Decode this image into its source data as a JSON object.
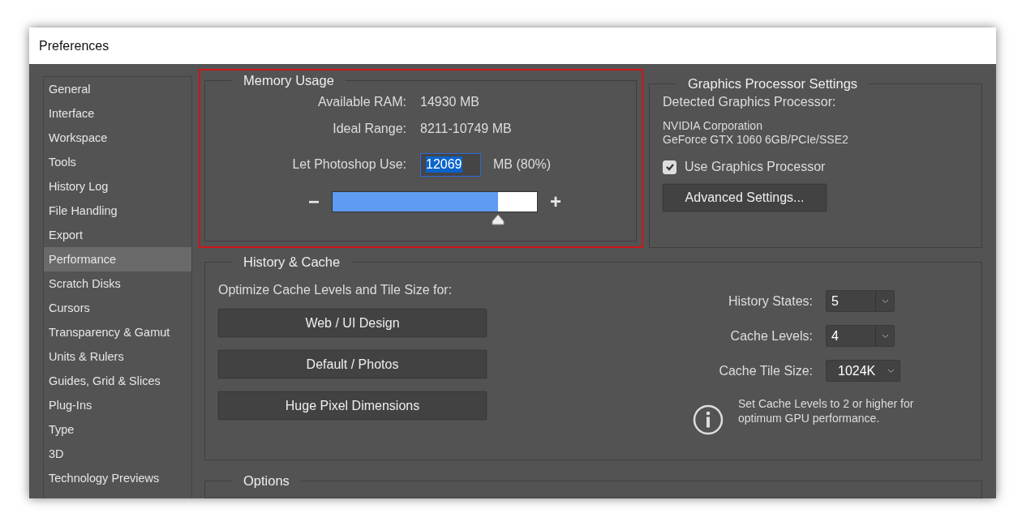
{
  "window": {
    "title": "Preferences"
  },
  "sidebar": {
    "items": [
      {
        "label": "General",
        "selected": false
      },
      {
        "label": "Interface",
        "selected": false
      },
      {
        "label": "Workspace",
        "selected": false
      },
      {
        "label": "Tools",
        "selected": false
      },
      {
        "label": "History Log",
        "selected": false
      },
      {
        "label": "File Handling",
        "selected": false
      },
      {
        "label": "Export",
        "selected": false
      },
      {
        "label": "Performance",
        "selected": true
      },
      {
        "label": "Scratch Disks",
        "selected": false
      },
      {
        "label": "Cursors",
        "selected": false
      },
      {
        "label": "Transparency & Gamut",
        "selected": false
      },
      {
        "label": "Units & Rulers",
        "selected": false
      },
      {
        "label": "Guides, Grid & Slices",
        "selected": false
      },
      {
        "label": "Plug-Ins",
        "selected": false
      },
      {
        "label": "Type",
        "selected": false
      },
      {
        "label": "3D",
        "selected": false
      },
      {
        "label": "Technology Previews",
        "selected": false
      }
    ]
  },
  "memory_usage": {
    "title": "Memory Usage",
    "highlighted": true,
    "rows": [
      {
        "label": "Available RAM:",
        "value": "14930 MB"
      },
      {
        "label": "Ideal Range:",
        "value": "8211-10749 MB"
      }
    ],
    "use": {
      "label": "Let Photoshop Use:",
      "value": "12069",
      "suffix": "MB (80%)"
    },
    "slider": {
      "minus": "−",
      "plus": "+",
      "level": 0.81
    }
  },
  "graphics_processor": {
    "title": "Graphics Processor Settings",
    "detected_label": "Detected Graphics Processor:",
    "processor_lines": [
      "NVIDIA Corporation",
      "GeForce GTX 1060 6GB/PCIe/SSE2"
    ],
    "use_gpu": {
      "label": "Use Graphics Processor",
      "checked": true
    },
    "advanced_button": "Advanced Settings..."
  },
  "history_cache": {
    "title": "History & Cache",
    "optimize_label": "Optimize Cache Levels and Tile Size for:",
    "buttons": [
      "Web / UI Design",
      "Default / Photos",
      "Huge Pixel Dimensions"
    ],
    "fields": [
      {
        "label": "History States:",
        "value": "5",
        "kind": "split"
      },
      {
        "label": "Cache Levels:",
        "value": "4",
        "kind": "split"
      },
      {
        "label": "Cache Tile Size:",
        "value": "1024K",
        "kind": "plain"
      }
    ],
    "info": "Set Cache Levels to 2 or higher for optimum GPU performance."
  },
  "options": {
    "title": "Options"
  }
}
